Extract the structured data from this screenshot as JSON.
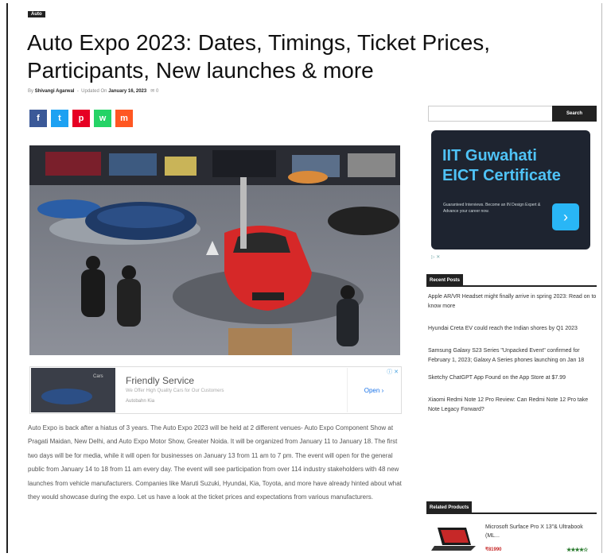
{
  "article": {
    "category": "Auto",
    "title": "Auto Expo 2023: Dates, Timings, Ticket Prices, Participants, New launches & more",
    "author_prefix": "By",
    "author": "Shivangi Agarwal",
    "updated_label": "Updated On",
    "date": "January 16, 2023",
    "comments": "0",
    "body": "Auto Expo is back after a hiatus of 3 years. The Auto Expo 2023 will be held at 2 different venues- Auto Expo Component Show at Pragati Maidan, New Delhi, and Auto Expo Motor Show, Greater Noida. It will be organized from January 11 to January 18. The first two days will be for media, while it will open for businesses on January 13 from 11 am to 7 pm. The event will open for the general public from January 14 to 18 from 11 am every day. The event will see participation from over 114 industry stakeholders with 48 new launches from vehicle manufacturers. Companies like Maruti Suzuki, Hyundai, Kia, Toyota, and more have already hinted about what they would showcase during the expo. Let us have a look at the ticket prices and expectations from various manufacturers."
  },
  "share": [
    {
      "name": "facebook",
      "icon": "f",
      "color": "#3b5998"
    },
    {
      "name": "twitter",
      "icon": "t",
      "color": "#1da1f2"
    },
    {
      "name": "pinterest",
      "icon": "p",
      "color": "#e60023"
    },
    {
      "name": "whatsapp",
      "icon": "w",
      "color": "#25d366"
    },
    {
      "name": "mix",
      "icon": "m",
      "color": "#ff5722"
    }
  ],
  "inline_ad": {
    "brand": "Cars",
    "title": "Friendly Service",
    "subtitle": "We Offer High Quality Cars for Our Customers",
    "domain": "Autobahn Kia",
    "cta": "Open",
    "cta_arrow": "›",
    "close": "ⓘ ✕"
  },
  "sidebar": {
    "search_button": "Search",
    "search_placeholder": "",
    "ad": {
      "title_line1": "IIT Guwahati",
      "title_line2": "EICT Certificate",
      "text": "Guaranteed Interviews. Become an IN Design Expert & Advance your career now.",
      "arrow": "›",
      "adchoices": "▷ ✕"
    },
    "recent_heading": "Recent Posts",
    "recent_posts": [
      "Apple AR/VR Headset might finally arrive in spring 2023: Read on to know more",
      "Hyundai Creta EV could reach the Indian shores by Q1 2023",
      "Samsung Galaxy S23 Series \"Unpacked Event\" confirmed for February 1, 2023; Galaxy A Series phones launching on Jan 18",
      "Sketchy ChatGPT App Found on the App Store at $7.99",
      "Xiaomi Redmi Note 12 Pro Review: Can Redmi Note 12 Pro take Note Legacy Forward?"
    ],
    "related_heading": "Related Products",
    "product": {
      "title": "Microsoft Surface Pro X 13\"& Ultrabook (ML...",
      "price": "₹81990",
      "stars": "★★★★☆"
    }
  },
  "colors": {
    "accent": "#222222",
    "ad_bg": "#1e2430",
    "ad_title": "#4fc3f7",
    "price": "#c62828"
  }
}
